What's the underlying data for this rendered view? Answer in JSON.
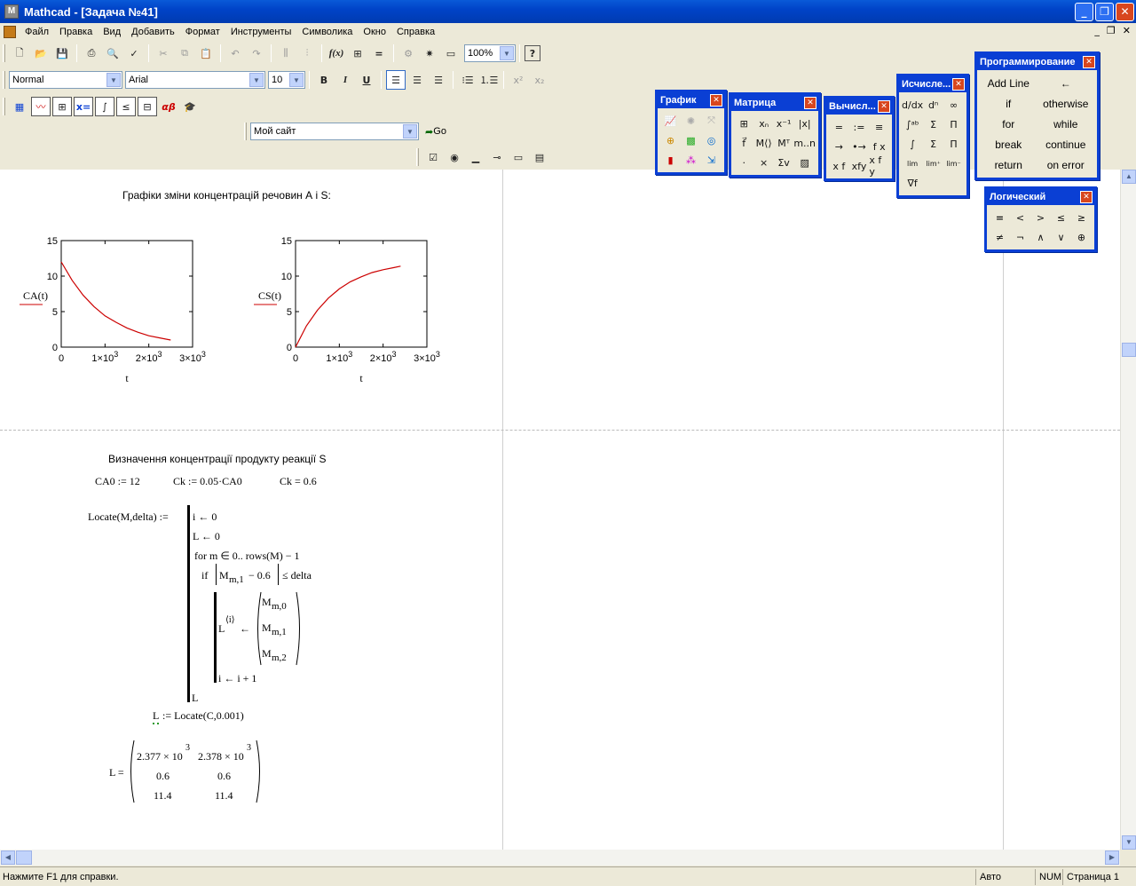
{
  "window": {
    "title": "Mathcad - [Задача №41]",
    "app_icon": "M",
    "min": "_",
    "max": "❐",
    "close": "✕"
  },
  "menu": [
    "Файл",
    "Правка",
    "Вид",
    "Добавить",
    "Формат",
    "Инструменты",
    "Символика",
    "Окно",
    "Справка"
  ],
  "mdi_buttons": [
    "_",
    "❐",
    "✕"
  ],
  "toolbar": {
    "zoom": "100%",
    "style": "Normal",
    "font": "Arial",
    "size": "10",
    "website": "Мой сайт",
    "go": "Go"
  },
  "palettes": {
    "graph": {
      "title": "График"
    },
    "matrix": {
      "title": "Матрица"
    },
    "calc": {
      "title": "Вычисл...",
      "items": [
        "=",
        ":=",
        "≡",
        "→",
        "•→",
        "f x",
        "x f",
        "xfy",
        "x f y"
      ]
    },
    "calculus": {
      "title": "Исчисле..."
    },
    "prog": {
      "title": "Программирование",
      "items": [
        "Add Line",
        "←",
        "if",
        "otherwise",
        "for",
        "while",
        "break",
        "continue",
        "return",
        "on error"
      ]
    },
    "logic": {
      "title": "Логический",
      "items": [
        "=",
        "<",
        ">",
        "≤",
        "≥",
        "≠",
        "¬",
        "∧",
        "∨",
        "⊕"
      ]
    }
  },
  "doc": {
    "heading1": "Графіки зміни концентрацій речовин А і S:",
    "heading2": "Визначення концентрації продукту реакції S",
    "defs": {
      "ca0": "CA0 := 12",
      "ck": "Ck := 0.05·CA0",
      "ckv": "Ck = 0.6"
    },
    "program": {
      "head": "Locate(M,delta) :=",
      "l1": "i ← 0",
      "l2": "L ← 0",
      "l3": "for  m ∈ 0.. rows(M) − 1",
      "l4a": "if",
      "l4b": "M",
      "l4c": "m,1",
      "l4d": " − 0.6",
      "l4e": "≤ delta",
      "l5a": "L",
      "l5b": "⟨i⟩",
      "l5c": "←",
      "v1": "M",
      "v1s": "m,0",
      "v2": "M",
      "v2s": "m,1",
      "v3": "M",
      "v3s": "m,2",
      "l6": "i ← i + 1",
      "l7": "L"
    },
    "call": {
      "lhs": "L",
      "rhs": ":= Locate(C,0.001)"
    },
    "result": {
      "label": "L =",
      "rows": [
        [
          "2.377 × 10",
          "3",
          "2.378 × 10",
          "3"
        ],
        [
          "0.6",
          "",
          "0.6",
          ""
        ],
        [
          "11.4",
          "",
          "11.4",
          ""
        ]
      ]
    }
  },
  "status": {
    "help": "Нажмите F1 для справки.",
    "mode": "Авто",
    "num": "NUM",
    "page": "Страница 1"
  },
  "chart_data": [
    {
      "type": "line",
      "ylabel": "CA(t)",
      "xlabel": "t",
      "xlim": [
        0,
        3000
      ],
      "ylim": [
        0,
        15
      ],
      "x_ticks": [
        "0",
        "1×10",
        "2×10",
        "3×10"
      ],
      "x_tick_exp": [
        "",
        "3",
        "3",
        "3"
      ],
      "y_ticks": [
        "0",
        "5",
        "10",
        "15"
      ],
      "series": [
        {
          "color": "#cc0000",
          "x": [
            0,
            250,
            500,
            750,
            1000,
            1250,
            1500,
            1750,
            2000,
            2250,
            2500
          ],
          "values": [
            12,
            9.4,
            7.3,
            5.7,
            4.4,
            3.5,
            2.7,
            2.1,
            1.6,
            1.3,
            1.0
          ]
        }
      ]
    },
    {
      "type": "line",
      "ylabel": "CS(t)",
      "xlabel": "t",
      "xlim": [
        0,
        3000
      ],
      "ylim": [
        0,
        15
      ],
      "x_ticks": [
        "0",
        "1×10",
        "2×10",
        "3×10"
      ],
      "x_tick_exp": [
        "",
        "3",
        "3",
        "3"
      ],
      "y_ticks": [
        "0",
        "5",
        "10",
        "15"
      ],
      "series": [
        {
          "color": "#cc0000",
          "x": [
            0,
            250,
            500,
            750,
            1000,
            1250,
            1500,
            1750,
            2000,
            2250,
            2400
          ],
          "values": [
            0,
            3.0,
            5.2,
            6.9,
            8.2,
            9.2,
            9.9,
            10.5,
            10.9,
            11.2,
            11.4
          ]
        }
      ]
    }
  ]
}
